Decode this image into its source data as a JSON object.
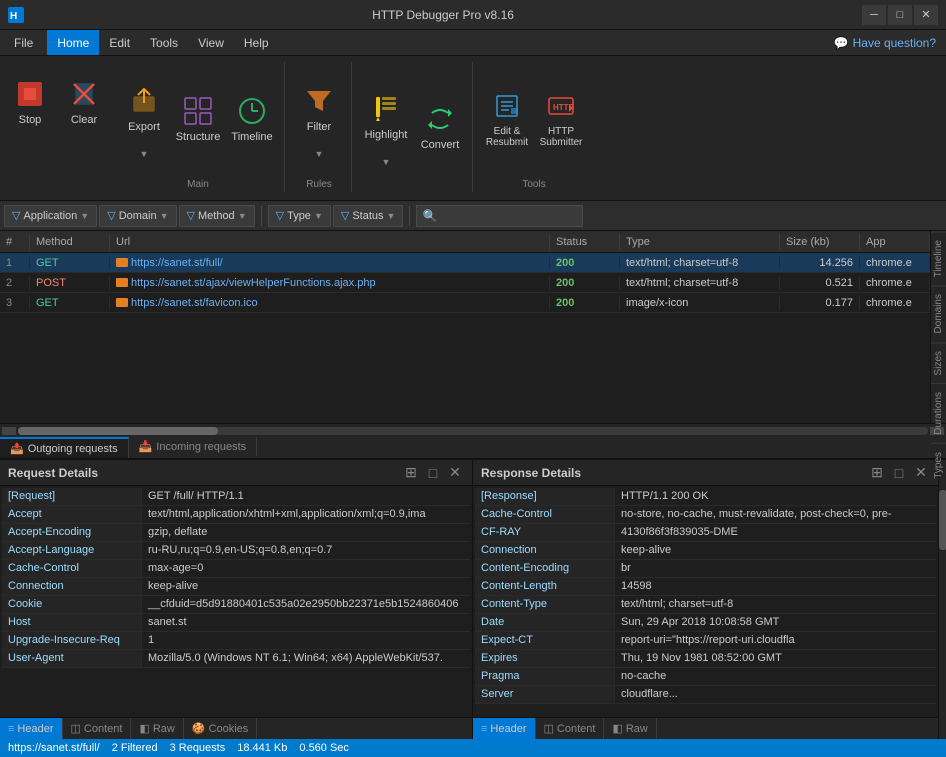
{
  "titleBar": {
    "title": "HTTP Debugger Pro v8.16",
    "minimizeLabel": "─",
    "maximizeLabel": "□",
    "closeLabel": "✕"
  },
  "menuBar": {
    "items": [
      "File",
      "Home",
      "Edit",
      "Tools",
      "View",
      "Help"
    ],
    "activeItem": "Home",
    "haveQuestion": "Have question?"
  },
  "toolbar": {
    "stop": {
      "label": "Stop",
      "icon": "■"
    },
    "clear": {
      "label": "Clear",
      "icon": "🗑"
    },
    "export": {
      "label": "Export",
      "icon": "📤"
    },
    "exportArrow": "▼",
    "mainLabel": "Main",
    "structure": {
      "label": "Structure",
      "icon": "⊞"
    },
    "timeline": {
      "label": "Timeline",
      "icon": "⏱"
    },
    "filter": {
      "label": "Filter",
      "icon": "▽"
    },
    "filterArrow": "▼",
    "rulesLabel": "Rules",
    "highlight": {
      "label": "Highlight",
      "icon": "🖊"
    },
    "highlightArrow": "▼",
    "convert": {
      "label": "Convert",
      "icon": "↻"
    },
    "editResubmit": {
      "label": "Edit &\nResubmit",
      "icon": "✏"
    },
    "httpSubmitter": {
      "label": "HTTP\nSubmitter",
      "icon": "📨"
    },
    "toolsLabel": "Tools"
  },
  "filterBar": {
    "application": {
      "label": "Application",
      "arrow": "▼"
    },
    "domain": {
      "label": "Domain",
      "arrow": "▼"
    },
    "method": {
      "label": "Method",
      "arrow": "▼"
    },
    "type": {
      "label": "Type",
      "arrow": "▼"
    },
    "status": {
      "label": "Status",
      "arrow": "▼"
    },
    "searchPlaceholder": ""
  },
  "tableHeaders": [
    "#",
    "Method",
    "Url",
    "Status",
    "Type",
    "Size (kb)",
    "App"
  ],
  "tableRows": [
    {
      "num": "1",
      "method": "GET",
      "methodType": "get",
      "urlIcon": true,
      "url": "https://sanet.st/full/",
      "status": "200",
      "type": "text/html; charset=utf-8",
      "size": "14.256",
      "app": "chrome.e"
    },
    {
      "num": "2",
      "method": "POST",
      "methodType": "post",
      "urlIcon": true,
      "url": "https://sanet.st/ajax/viewHelperFunctions.ajax.php",
      "status": "200",
      "type": "text/html; charset=utf-8",
      "size": "0.521",
      "app": "chrome.e"
    },
    {
      "num": "3",
      "method": "GET",
      "methodType": "get",
      "urlIcon": true,
      "url": "https://sanet.st/favicon.ico",
      "status": "200",
      "type": "image/x-icon",
      "size": "0.177",
      "app": "chrome.e"
    }
  ],
  "rightSidebar": {
    "tabs": [
      "Timeline",
      "Domains",
      "Sizes",
      "Durations",
      "Types"
    ]
  },
  "bottomTabs": {
    "outgoing": "Outgoing requests",
    "incoming": "Incoming requests"
  },
  "requestDetails": {
    "title": "Request Details",
    "rows": [
      {
        "key": "[Request]",
        "value": "GET /full/ HTTP/1.1"
      },
      {
        "key": "Accept",
        "value": "text/html,application/xhtml+xml,application/xml;q=0.9,ima"
      },
      {
        "key": "Accept-Encoding",
        "value": "gzip, deflate"
      },
      {
        "key": "Accept-Language",
        "value": "ru-RU,ru;q=0.9,en-US;q=0.8,en;q=0.7"
      },
      {
        "key": "Cache-Control",
        "value": "max-age=0"
      },
      {
        "key": "Connection",
        "value": "keep-alive"
      },
      {
        "key": "Cookie",
        "value": "__cfduid=d5d91880401c535a02e2950bb22371e5b1524860406"
      },
      {
        "key": "Host",
        "value": "sanet.st"
      },
      {
        "key": "Upgrade-Insecure-Req",
        "value": "1"
      },
      {
        "key": "User-Agent",
        "value": "Mozilla/5.0 (Windows NT 6.1; Win64; x64) AppleWebKit/537."
      }
    ],
    "innerTabs": [
      "Header",
      "Content",
      "Raw",
      "Cookies"
    ]
  },
  "responseDetails": {
    "title": "Response Details",
    "rows": [
      {
        "key": "[Response]",
        "value": "HTTP/1.1 200 OK"
      },
      {
        "key": "Cache-Control",
        "value": "no-store, no-cache, must-revalidate, post-check=0, pre-"
      },
      {
        "key": "CF-RAY",
        "value": "4130f86f3f839035-DME"
      },
      {
        "key": "Connection",
        "value": "keep-alive"
      },
      {
        "key": "Content-Encoding",
        "value": "br"
      },
      {
        "key": "Content-Length",
        "value": "14598"
      },
      {
        "key": "Content-Type",
        "value": "text/html; charset=utf-8"
      },
      {
        "key": "Date",
        "value": "Sun, 29 Apr 2018 10:08:58 GMT"
      },
      {
        "key": "Expect-CT",
        "value": "report-uri=\"https://report-uri.cloudfla"
      },
      {
        "key": "Expires",
        "value": "Thu, 19 Nov 1981 08:52:00 GMT"
      },
      {
        "key": "Pragma",
        "value": "no-cache"
      },
      {
        "key": "Server",
        "value": "cloudflare..."
      }
    ],
    "innerTabs": [
      "Header",
      "Content",
      "Raw"
    ]
  },
  "statusBar": {
    "filtered": "2 Filtered",
    "requests": "3 Requests",
    "size": "18.441 Kb",
    "time": "0.560 Sec",
    "url": "https://sanet.st/full/"
  }
}
